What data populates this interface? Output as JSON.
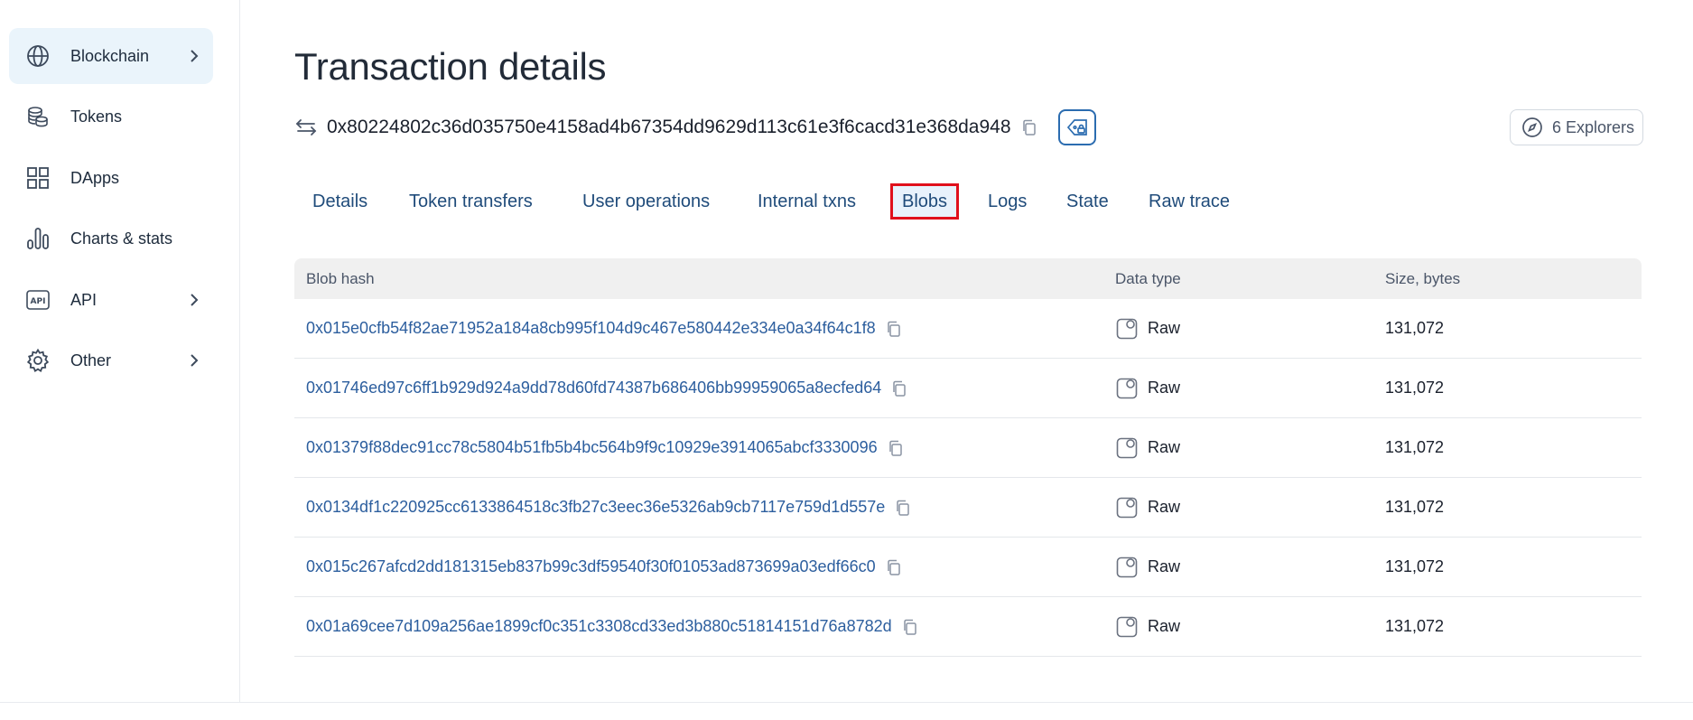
{
  "sidebar": {
    "items": [
      {
        "label": "Blockchain",
        "icon": "globe-icon",
        "active": true,
        "has_chevron": true
      },
      {
        "label": "Tokens",
        "icon": "coins-icon",
        "active": false,
        "has_chevron": false
      },
      {
        "label": "DApps",
        "icon": "grid-icon",
        "active": false,
        "has_chevron": false
      },
      {
        "label": "Charts & stats",
        "icon": "bar-chart-icon",
        "active": false,
        "has_chevron": false
      },
      {
        "label": "API",
        "icon": "api-icon",
        "active": false,
        "has_chevron": true
      },
      {
        "label": "Other",
        "icon": "gear-icon",
        "active": false,
        "has_chevron": true
      }
    ]
  },
  "header": {
    "title": "Transaction details",
    "tx_hash": "0x80224802c36d035750e4158ad4b67354dd9629d113c61e3f6cacd31e368da948",
    "explorers_label": "6 Explorers"
  },
  "tabs": [
    {
      "label": "Details",
      "active": false
    },
    {
      "label": "Token transfers",
      "active": false
    },
    {
      "label": "User operations",
      "active": false
    },
    {
      "label": "Internal txns",
      "active": false
    },
    {
      "label": "Blobs",
      "active": true
    },
    {
      "label": "Logs",
      "active": false
    },
    {
      "label": "State",
      "active": false
    },
    {
      "label": "Raw trace",
      "active": false
    }
  ],
  "table": {
    "headers": {
      "hash": "Blob hash",
      "type": "Data type",
      "size": "Size, bytes"
    },
    "rows": [
      {
        "hash": "0x015e0cfb54f82ae71952a184a8cb995f104d9c467e580442e334e0a34f64c1f8",
        "type": "Raw",
        "size": "131,072"
      },
      {
        "hash": "0x01746ed97c6ff1b929d924a9dd78d60fd74387b686406bb99959065a8ecfed64",
        "type": "Raw",
        "size": "131,072"
      },
      {
        "hash": "0x01379f88dec91cc78c5804b51fb5b4bc564b9f9c10929e3914065abcf3330096",
        "type": "Raw",
        "size": "131,072"
      },
      {
        "hash": "0x0134df1c220925cc6133864518c3fb27c3eec36e5326ab9cb7117e759d1d557e",
        "type": "Raw",
        "size": "131,072"
      },
      {
        "hash": "0x015c267afcd2dd181315eb837b99c3df59540f30f01053ad873699a03edf66c0",
        "type": "Raw",
        "size": "131,072"
      },
      {
        "hash": "0x01a69cee7d109a256ae1899cf0c351c3308cd33ed3b880c51814151d76a8782d",
        "type": "Raw",
        "size": "131,072"
      }
    ]
  },
  "colors": {
    "link": "#2c5e9e",
    "tab": "#1f4b7a",
    "highlight_box": "#e0101c",
    "active_nav_bg": "#eaf4fb"
  }
}
